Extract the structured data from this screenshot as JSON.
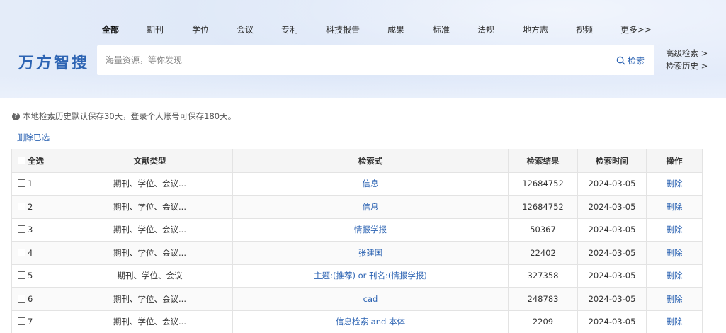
{
  "nav": {
    "tabs": [
      {
        "label": "全部",
        "active": true
      },
      {
        "label": "期刊"
      },
      {
        "label": "学位"
      },
      {
        "label": "会议"
      },
      {
        "label": "专利"
      },
      {
        "label": "科技报告"
      },
      {
        "label": "成果"
      },
      {
        "label": "标准"
      },
      {
        "label": "法规"
      },
      {
        "label": "地方志"
      },
      {
        "label": "视频"
      },
      {
        "label": "更多>>"
      }
    ]
  },
  "logo": "万方智搜",
  "search": {
    "placeholder": "海量资源，等你发现",
    "button": "检索"
  },
  "side_links": {
    "advanced": "高级检索 >",
    "history": "检索历史 >"
  },
  "notice": "本地检索历史默认保存30天，登录个人账号可保存180天。",
  "delete_selected": "删除已选",
  "table": {
    "headers": {
      "select_all": "全选",
      "type": "文献类型",
      "query": "检索式",
      "results": "检索结果",
      "time": "检索时间",
      "action": "操作"
    },
    "rows": [
      {
        "index": "1",
        "type": "期刊、学位、会议...",
        "query": "信息",
        "results": "12684752",
        "time": "2024-03-05",
        "action": "删除"
      },
      {
        "index": "2",
        "type": "期刊、学位、会议...",
        "query": "信息",
        "results": "12684752",
        "time": "2024-03-05",
        "action": "删除"
      },
      {
        "index": "3",
        "type": "期刊、学位、会议...",
        "query": "情报学报",
        "results": "50367",
        "time": "2024-03-05",
        "action": "删除"
      },
      {
        "index": "4",
        "type": "期刊、学位、会议...",
        "query": "张建国",
        "results": "22402",
        "time": "2024-03-05",
        "action": "删除"
      },
      {
        "index": "5",
        "type": "期刊、学位、会议",
        "query": "主题:(推荐) or 刊名:(情报学报)",
        "results": "327358",
        "time": "2024-03-05",
        "action": "删除"
      },
      {
        "index": "6",
        "type": "期刊、学位、会议...",
        "query": "cad",
        "results": "248783",
        "time": "2024-03-05",
        "action": "删除"
      },
      {
        "index": "7",
        "type": "期刊、学位、会议...",
        "query": "信息检索 and 本体",
        "results": "2209",
        "time": "2024-03-05",
        "action": "删除"
      }
    ]
  }
}
